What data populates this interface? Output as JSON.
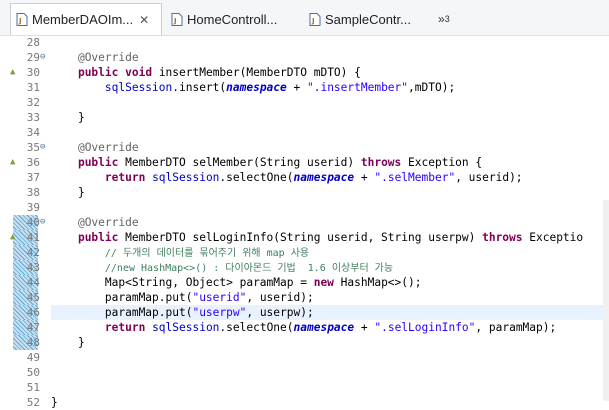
{
  "tabs": [
    {
      "label": "MemberDAOIm...",
      "close": "✕",
      "active": true
    },
    {
      "label": "HomeControll...",
      "active": false
    },
    {
      "label": "SampleContr...",
      "active": false
    }
  ],
  "overflow_label": "»",
  "overflow_count": "3",
  "line_numbers": [
    "28",
    "29",
    "30",
    "31",
    "32",
    "33",
    "34",
    "35",
    "36",
    "37",
    "38",
    "39",
    "40",
    "41",
    "42",
    "43",
    "44",
    "45",
    "46",
    "47",
    "48",
    "49",
    "50",
    "51",
    "52"
  ],
  "code": {
    "l29_ann": "@Override",
    "l30_kw1": "public",
    "l30_kw2": "void",
    "l30_rest": " insertMember(MemberDTO mDTO) {",
    "l31_fld": "sqlSession",
    "l31_a": ".insert(",
    "l31_ns": "namespace",
    "l31_b": " + ",
    "l31_str": "\".insertMember\"",
    "l31_c": ",mDTO);",
    "l33_brace": "}",
    "l35_ann": "@Override",
    "l36_kw1": "public",
    "l36_a": " MemberDTO selMember(String userid) ",
    "l36_kw2": "throws",
    "l36_b": " Exception {",
    "l37_kw": "return",
    "l37_fld": "sqlSession",
    "l37_a": ".selectOne(",
    "l37_ns": "namespace",
    "l37_b": " + ",
    "l37_str": "\".selMember\"",
    "l37_c": ", userid);",
    "l38_brace": "}",
    "l40_ann": "@Override",
    "l41_kw1": "public",
    "l41_a": " MemberDTO selLoginInfo(String userid, String userpw) ",
    "l41_kw2": "throws",
    "l41_b": " Exceptio",
    "l42_cmt": "// 두개의 데이터를 묶어주기 위해 map 사용",
    "l43_cmt": "//new HashMap<>() : 다이아몬드 기법  1.6 이상부터 가능",
    "l44_a": "Map<String, Object> paramMap = ",
    "l44_kw": "new",
    "l44_b": " HashMap<>();",
    "l45_a": "paramMap.put(",
    "l45_str": "\"userid\"",
    "l45_b": ", userid);",
    "l46_a": "paramMap.put(",
    "l46_str": "\"userpw\"",
    "l46_b": ", userpw);",
    "l47_kw": "return",
    "l47_fld": "sqlSession",
    "l47_a": ".selectOne(",
    "l47_ns": "namespace",
    "l47_b": " + ",
    "l47_str": "\".selLoginInfo\"",
    "l47_c": ", paramMap);",
    "l48_brace": "}",
    "l52_brace": "}"
  },
  "markers": {
    "fold": "⊖",
    "override": "▲"
  }
}
